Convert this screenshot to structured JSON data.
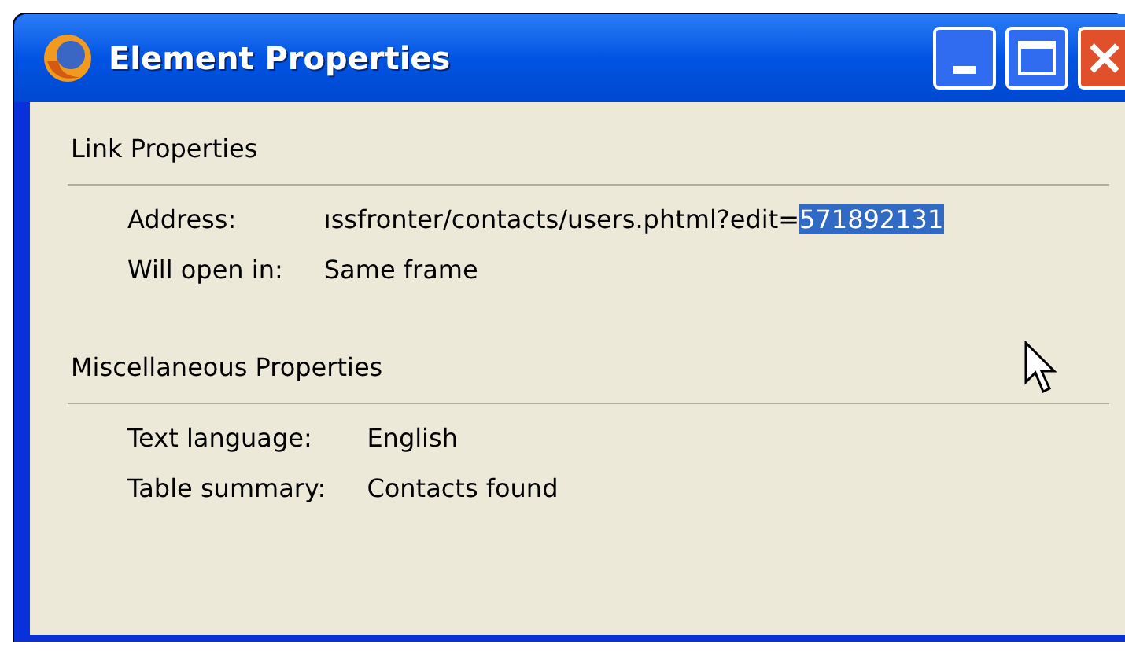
{
  "window": {
    "title": "Element Properties"
  },
  "sections": [
    {
      "heading": "Link Properties",
      "rows": [
        {
          "label": "Address:",
          "segments": [
            {
              "text": "ıssfronter/contacts/users.phtml?edit=",
              "selected": false
            },
            {
              "text": "571892131",
              "selected": true
            }
          ]
        },
        {
          "label": "Will open in:",
          "segments": [
            {
              "text": "Same frame",
              "selected": false
            }
          ]
        }
      ]
    },
    {
      "heading": "Miscellaneous Properties",
      "rows": [
        {
          "label": "Text language:",
          "segments": [
            {
              "text": "English",
              "selected": false
            }
          ]
        },
        {
          "label": "Table summary:",
          "segments": [
            {
              "text": "Contacts found",
              "selected": false
            }
          ]
        }
      ]
    }
  ]
}
